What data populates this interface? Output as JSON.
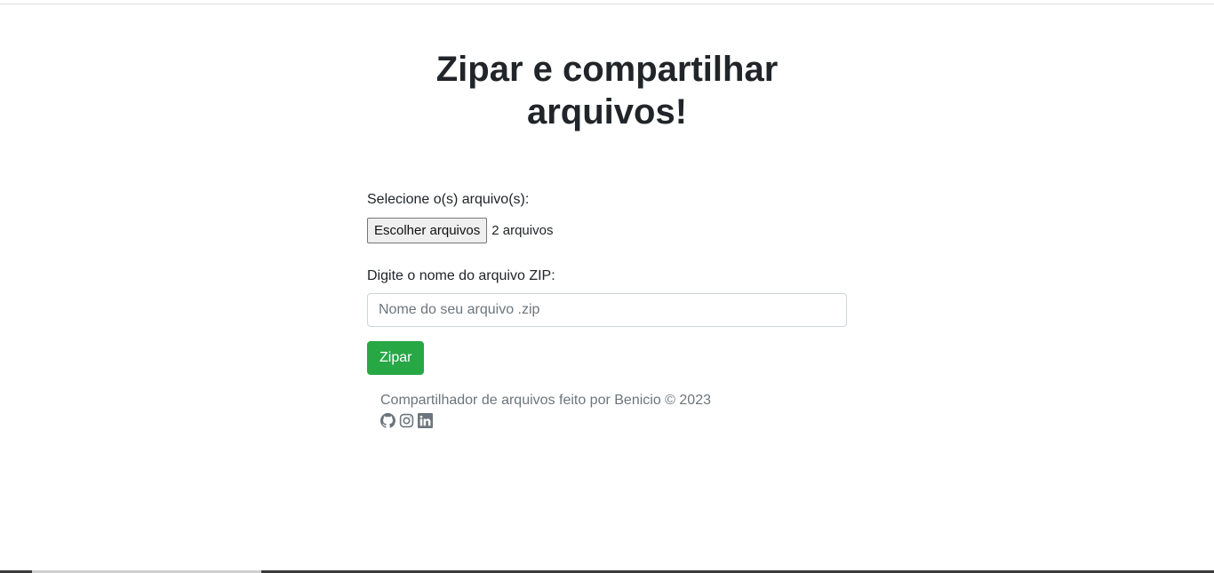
{
  "page": {
    "title_line1": "Zipar e compartilhar",
    "title_line2": "arquivos!"
  },
  "form": {
    "files_label": "Selecione o(s) arquivo(s):",
    "files_button": "Escolher arquivos",
    "files_selected": "2 arquivos",
    "zip_label": "Digite o nome do arquivo ZIP:",
    "zip_placeholder": "Nome do seu arquivo .zip",
    "zip_value": "",
    "submit_label": "Zipar"
  },
  "footer": {
    "text": "Compartilhador de arquivos feito por Benicio © 2023",
    "icons": [
      "github-icon",
      "instagram-icon",
      "linkedin-icon"
    ]
  },
  "colors": {
    "primary_button": "#28a745",
    "muted_text": "#6c757d",
    "heading": "#212529"
  }
}
